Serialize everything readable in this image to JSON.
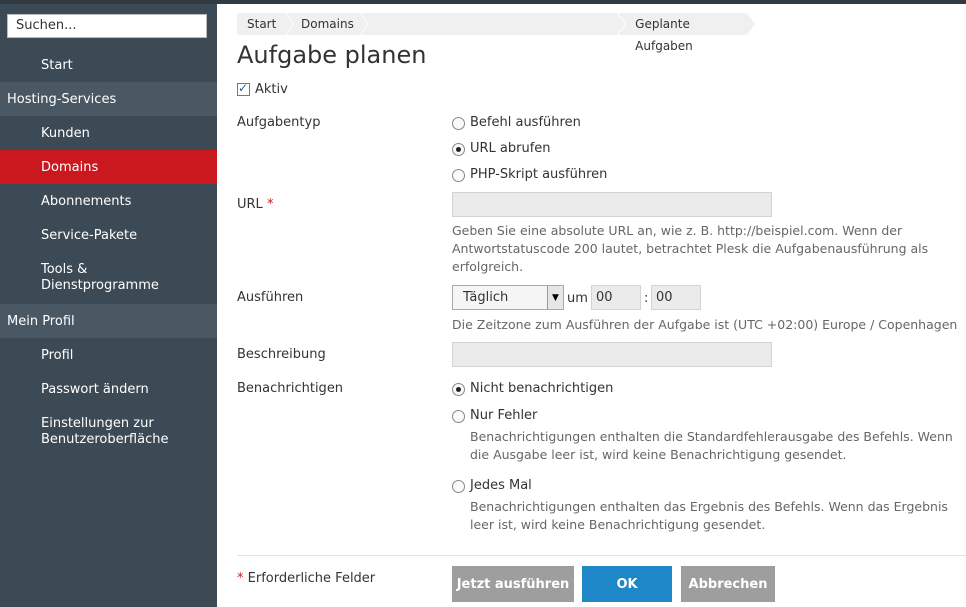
{
  "sidebar": {
    "search_placeholder": "Suchen...",
    "start": "Start",
    "sections": [
      {
        "title": "Hosting-Services",
        "items": [
          "Kunden",
          "Domains",
          "Abonnements",
          "Service-Pakete",
          "Tools & Dienstprogramme"
        ]
      },
      {
        "title": "Mein Profil",
        "items": [
          "Profil",
          "Passwort ändern",
          "Einstellungen zur Benutzeroberfläche"
        ]
      }
    ],
    "active_item": "Domains"
  },
  "breadcrumb": [
    "Start",
    "Domains",
    "",
    "Geplante Aufgaben"
  ],
  "page_title": "Aufgabe planen",
  "active_label": "Aktiv",
  "active_checked": true,
  "task_type": {
    "label": "Aufgabentyp",
    "options": [
      "Befehl ausführen",
      "URL abrufen",
      "PHP-Skript ausführen"
    ],
    "selected": "URL abrufen"
  },
  "url": {
    "label": "URL",
    "required_mark": "*",
    "value": "",
    "hint": "Geben Sie eine absolute URL an, wie z. B. http://beispiel.com. Wenn der Antwortstatuscode 200 lautet, betrachtet Plesk die Aufgabenausführung als erfolgreich."
  },
  "run": {
    "label": "Ausführen",
    "frequency": "Täglich",
    "at_label": "um",
    "hour": "00",
    "separator": ":",
    "minute": "00",
    "hint": "Die Zeitzone zum Ausführen der Aufgabe ist (UTC +02:00) Europe / Copenhagen"
  },
  "description": {
    "label": "Beschreibung",
    "value": ""
  },
  "notify": {
    "label": "Benachrichtigen",
    "options": [
      {
        "label": "Nicht benachrichtigen",
        "hint": ""
      },
      {
        "label": "Nur Fehler",
        "hint": "Benachrichtigungen enthalten die Standardfehlerausgabe des Befehls. Wenn die Ausgabe leer ist, wird keine Benachrichtigung gesendet."
      },
      {
        "label": "Jedes Mal",
        "hint": "Benachrichtigungen enthalten das Ergebnis des Befehls. Wenn das Ergebnis leer ist, wird keine Benachrichtigung gesendet."
      }
    ],
    "selected": "Nicht benachrichtigen"
  },
  "footer": {
    "required_mark": "*",
    "required_note": "Erforderliche Felder",
    "run_now": "Jetzt ausführen",
    "ok": "OK",
    "cancel": "Abbrechen"
  },
  "colors": {
    "sidebar_bg": "#3c4a55",
    "section_bg": "#4a5864",
    "active_bg": "#c9181e",
    "ok_button": "#1e87c8",
    "gray_button": "#9e9e9e"
  }
}
